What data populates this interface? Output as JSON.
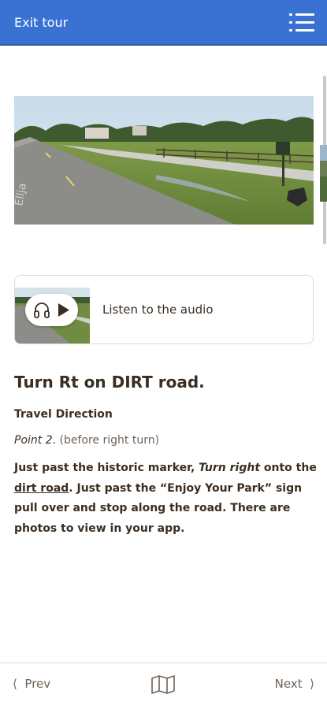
{
  "header": {
    "exit_label": "Exit tour",
    "menu_icon": "list-icon",
    "background_color": "#3a72d4"
  },
  "audio": {
    "label": "Listen to the audio",
    "icons": [
      "headphones-icon",
      "play-icon"
    ]
  },
  "stop": {
    "title": "Turn Rt on DIRT road.",
    "subheading": "Travel Direction",
    "point_label": "Point 2",
    "point_punct": ".",
    "point_note": " (before right turn)",
    "body": {
      "part1": "Just past the historic marker, ",
      "part2": "Turn right",
      "part3": " onto the ",
      "part4": "dirt road",
      "part5": ". Just past the “Enjoy Your Park” sign pull over and stop along the road. There are photos to view in your app."
    }
  },
  "footer": {
    "prev_label": "Prev",
    "next_label": "Next",
    "map_icon": "map-icon"
  }
}
